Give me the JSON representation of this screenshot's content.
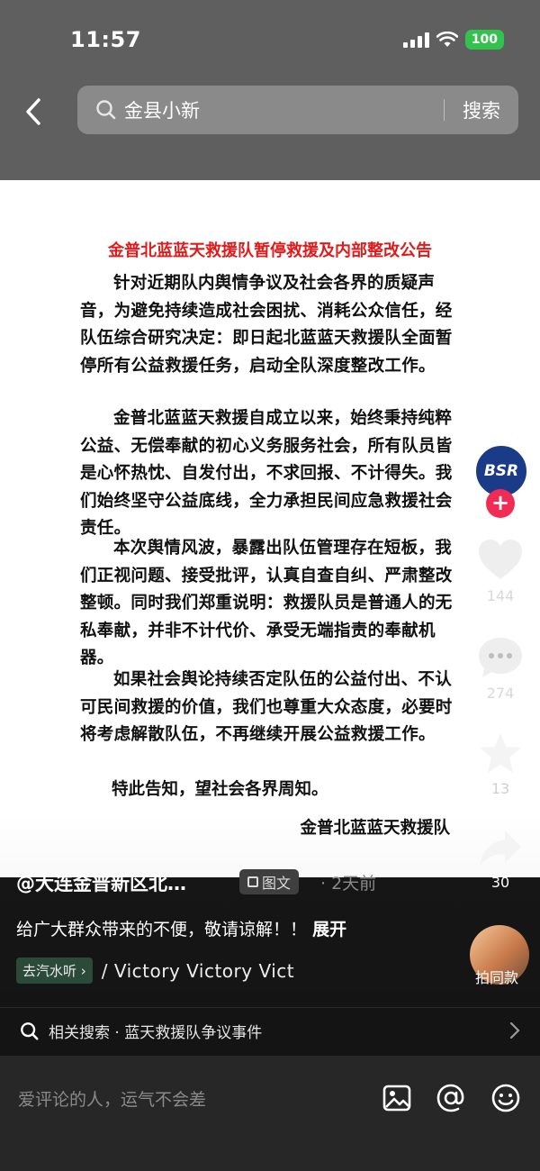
{
  "status": {
    "time": "11:57",
    "battery": "100"
  },
  "search": {
    "query": "金县小新",
    "button": "搜索"
  },
  "document": {
    "title": "金普北蓝蓝天救援队暂停救援及内部整改公告",
    "paragraphs": [
      "针对近期队内舆情争议及社会各界的质疑声音，为避免持续造成社会困扰、消耗公众信任，经队伍综合研究决定：即日起北蓝蓝天救援队全面暂停所有公益救援任务，启动全队深度整改工作。",
      "金普北蓝蓝天救援自成立以来，始终秉持纯粹公益、无偿奉献的初心义务服务社会，所有队员皆是心怀热忱、自发付出，不求回报、不计得失。我们始终坚守公益底线，全力承担民间应急救援社会责任。",
      "本次舆情风波，暴露出队伍管理存在短板，我们正视问题、接受批评，认真自查自纠、严肃整改整顿。同时我们郑重说明：救援队员是普通人的无私奉献，并非不计代价、承受无端指责的奉献机器。",
      "如果社会舆论持续否定队伍的公益付出、不认可民间救援的价值，我们也尊重大众态度，必要时将考虑解散队伍，不再继续开展公益救援工作。"
    ],
    "closing": "特此告知，望社会各界周知。",
    "signature": "金普北蓝蓝天救援队"
  },
  "rail": {
    "avatar_text": "BSR",
    "follow": "+",
    "likes": "144",
    "comments": "274",
    "favorites": "13",
    "shares": "30"
  },
  "post": {
    "author": "@大连金普新区北…",
    "type_tag": "图文",
    "time_ago": "· 2天前",
    "caption": "给广大群众带来的不便，敬请谅解！！",
    "expand": "展开",
    "music_tag": "去汽水听 ›",
    "music_text": "/ Victory  Victory  Vict",
    "same_style": "拍同款"
  },
  "related_search": {
    "text": "相关搜索 · 蓝天救援队争议事件"
  },
  "comment_bar": {
    "placeholder": "爱评论的人，运气不会差"
  },
  "colors": {
    "title_red": "#e11b1b",
    "follow_pink": "#f02c55",
    "battery_green": "#33c24d"
  }
}
